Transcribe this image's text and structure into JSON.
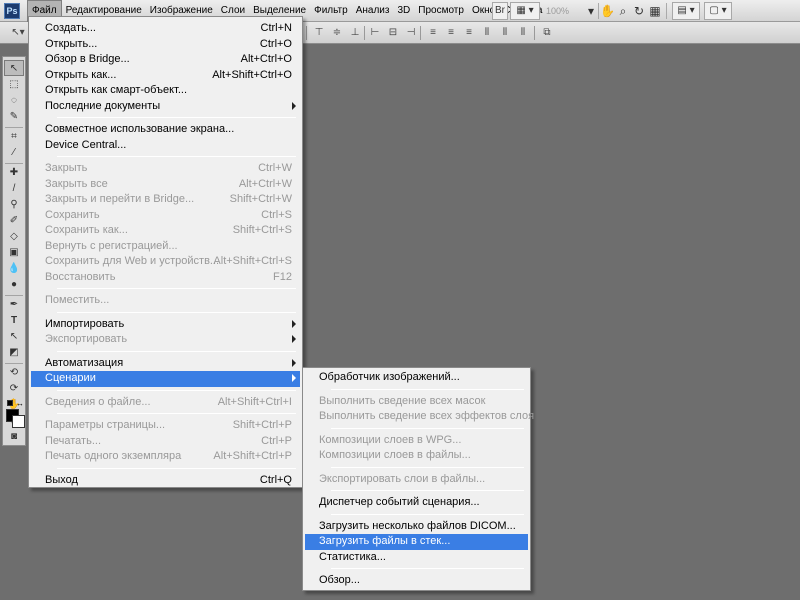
{
  "app": {
    "logo": "Ps",
    "zoom": "100%"
  },
  "menubar": [
    "Файл",
    "Редактирование",
    "Изображение",
    "Слои",
    "Выделение",
    "Фильтр",
    "Анализ",
    "3D",
    "Просмотр",
    "Окно",
    "Справка"
  ],
  "menubar_active_index": 0,
  "toolbar_icons": [
    "mini-bridge-icon",
    "frame-icon",
    "hand-icon",
    "zoom-icon",
    "rotate-view-icon",
    "arrange-documents-icon",
    "screen-mode-icon"
  ],
  "options_bar_icons": [
    "move-tool-icon",
    "align-top-icon",
    "align-vcenter-icon",
    "align-bottom-icon",
    "align-left-icon",
    "align-hcenter-icon",
    "align-right-icon",
    "distribute-top-icon",
    "distribute-vcenter-icon",
    "distribute-bottom-icon",
    "distribute-left-icon",
    "distribute-hcenter-icon",
    "distribute-right-icon",
    "auto-align-icon"
  ],
  "tools": [
    "move-tool-icon",
    "marquee-tool-icon",
    "lasso-tool-icon",
    "quick-select-tool-icon",
    "crop-tool-icon",
    "eyedropper-tool-icon",
    "healing-brush-tool-icon",
    "brush-tool-icon",
    "clone-stamp-tool-icon",
    "history-brush-tool-icon",
    "eraser-tool-icon",
    "gradient-tool-icon",
    "blur-tool-icon",
    "dodge-tool-icon",
    "pen-tool-icon",
    "type-tool-icon",
    "path-selection-tool-icon",
    "shape-tool-icon",
    "3d-rotate-tool-icon",
    "3d-orbit-tool-icon",
    "hand-tool-icon",
    "zoom-tool-icon",
    "swap-colors-icon",
    "foreground-color-swatch",
    "background-color-swatch",
    "quick-mask-icon"
  ],
  "colors": {
    "foreground": "#000000",
    "background": "#ffffff",
    "highlight": "#3a7ee4",
    "workspace": "#6e6e6e"
  },
  "file_menu": {
    "items": [
      {
        "label": "Создать...",
        "shortcut": "Ctrl+N",
        "enabled": true
      },
      {
        "label": "Открыть...",
        "shortcut": "Ctrl+O",
        "enabled": true
      },
      {
        "label": "Обзор в Bridge...",
        "shortcut": "Alt+Ctrl+O",
        "enabled": true
      },
      {
        "label": "Открыть как...",
        "shortcut": "Alt+Shift+Ctrl+O",
        "enabled": true
      },
      {
        "label": "Открыть как смарт-объект...",
        "shortcut": "",
        "enabled": true
      },
      {
        "label": "Последние документы",
        "shortcut": "",
        "enabled": true,
        "submenu": true
      },
      {
        "separator": true
      },
      {
        "label": "Совместное использование экрана...",
        "shortcut": "",
        "enabled": true
      },
      {
        "label": "Device Central...",
        "shortcut": "",
        "enabled": true
      },
      {
        "separator": true
      },
      {
        "label": "Закрыть",
        "shortcut": "Ctrl+W",
        "enabled": false
      },
      {
        "label": "Закрыть все",
        "shortcut": "Alt+Ctrl+W",
        "enabled": false
      },
      {
        "label": "Закрыть и перейти в Bridge...",
        "shortcut": "Shift+Ctrl+W",
        "enabled": false
      },
      {
        "label": "Сохранить",
        "shortcut": "Ctrl+S",
        "enabled": false
      },
      {
        "label": "Сохранить как...",
        "shortcut": "Shift+Ctrl+S",
        "enabled": false
      },
      {
        "label": "Вернуть с регистрацией...",
        "shortcut": "",
        "enabled": false
      },
      {
        "label": "Сохранить для Web и устройств...",
        "shortcut": "Alt+Shift+Ctrl+S",
        "enabled": false
      },
      {
        "label": "Восстановить",
        "shortcut": "F12",
        "enabled": false
      },
      {
        "separator": true
      },
      {
        "label": "Поместить...",
        "shortcut": "",
        "enabled": false
      },
      {
        "separator": true
      },
      {
        "label": "Импортировать",
        "shortcut": "",
        "enabled": true,
        "submenu": true
      },
      {
        "label": "Экспортировать",
        "shortcut": "",
        "enabled": false,
        "submenu": true
      },
      {
        "separator": true
      },
      {
        "label": "Автоматизация",
        "shortcut": "",
        "enabled": true,
        "submenu": true
      },
      {
        "label": "Сценарии",
        "shortcut": "",
        "enabled": true,
        "submenu": true,
        "highlighted": true
      },
      {
        "separator": true
      },
      {
        "label": "Сведения о файле...",
        "shortcut": "Alt+Shift+Ctrl+I",
        "enabled": false
      },
      {
        "separator": true
      },
      {
        "label": "Параметры страницы...",
        "shortcut": "Shift+Ctrl+P",
        "enabled": false
      },
      {
        "label": "Печатать...",
        "shortcut": "Ctrl+P",
        "enabled": false
      },
      {
        "label": "Печать одного экземпляра",
        "shortcut": "Alt+Shift+Ctrl+P",
        "enabled": false
      },
      {
        "separator": true
      },
      {
        "label": "Выход",
        "shortcut": "Ctrl+Q",
        "enabled": true
      }
    ]
  },
  "scripts_menu": {
    "items": [
      {
        "label": "Обработчик изображений...",
        "enabled": true
      },
      {
        "separator": true
      },
      {
        "label": "Выполнить сведение всех масок",
        "enabled": false
      },
      {
        "label": "Выполнить сведение всех эффектов слоя",
        "enabled": false
      },
      {
        "separator": true
      },
      {
        "label": "Композиции слоев в WPG...",
        "enabled": false
      },
      {
        "label": "Композиции слоев в файлы...",
        "enabled": false
      },
      {
        "separator": true
      },
      {
        "label": "Экспортировать слои в файлы...",
        "enabled": false
      },
      {
        "separator": true
      },
      {
        "label": "Диспетчер событий сценария...",
        "enabled": true
      },
      {
        "separator": true
      },
      {
        "label": "Загрузить несколько файлов DICOM...",
        "enabled": true
      },
      {
        "label": "Загрузить файлы в стек...",
        "enabled": true,
        "highlighted": true
      },
      {
        "label": "Статистика...",
        "enabled": true
      },
      {
        "separator": true
      },
      {
        "label": "Обзор...",
        "enabled": true
      }
    ]
  }
}
